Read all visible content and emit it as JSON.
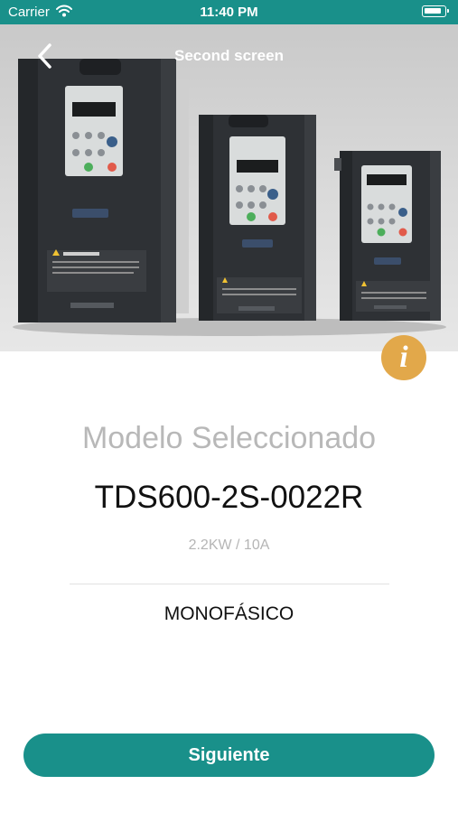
{
  "status_bar": {
    "carrier": "Carrier",
    "time": "11:40 PM"
  },
  "nav": {
    "title": "Second screen"
  },
  "content": {
    "label": "Modelo Seleccionado",
    "model": "TDS600-2S-0022R",
    "spec": "2.2KW / 10A",
    "phase": "MONOFÁSICO"
  },
  "actions": {
    "info_glyph": "i",
    "next_label": "Siguiente"
  },
  "colors": {
    "primary": "#19908a",
    "info": "#e2a84a"
  }
}
